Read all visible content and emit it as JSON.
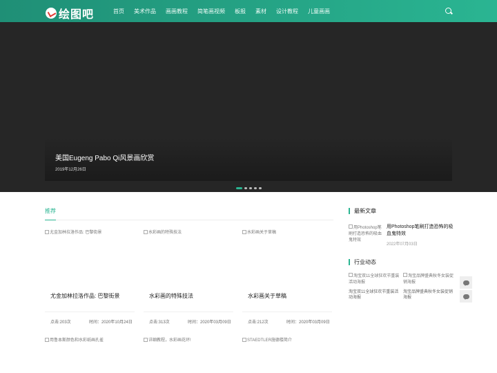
{
  "header": {
    "logo_text": "绘图吧",
    "nav": [
      "首页",
      "美术作品",
      "画画教程",
      "简笔画视频",
      "板报",
      "素材",
      "设计教程",
      "儿童画画"
    ]
  },
  "banner": {
    "title": "美国Eugeng Pabo Qi风景画欣赏",
    "date": "2019年12月26日"
  },
  "recommend": {
    "title": "推荐",
    "cards": [
      {
        "img_alt": "尤金加林拉洛作品: 巴黎街景",
        "title": "尤金加林拉洛作品: 巴黎街景",
        "views": "点击:203次",
        "time": "时间：2020年10月24日"
      },
      {
        "img_alt": "水彩画的特殊技法",
        "title": "水彩画的特殊技法",
        "views": "点击:313次",
        "time": "时间：2020年03月09日"
      },
      {
        "img_alt": "水彩画关于草稿",
        "title": "水彩画关于草稿",
        "views": "点击:212次",
        "time": "时间：2020年03月09日"
      }
    ],
    "more_cards": [
      {
        "img_alt": "用鲁本斯颜色和水彩纸画孔雀"
      },
      {
        "img_alt": "详细教程，水彩画花环!"
      },
      {
        "img_alt": "STAEDTLER施德楼简介"
      }
    ]
  },
  "sidebar": {
    "latest_title": "最新文章",
    "latest": {
      "img_alt": "用Photoshop笔刷打造恐怖的吸血鬼特效",
      "title": "用Photoshop笔刷打造恐怖的吸血鬼特效",
      "date": "2022年07月03日"
    },
    "industry_title": "行业动态",
    "industry": [
      {
        "img_alt": "淘宝双11全球狂欢节重装活动海报",
        "caption": "淘宝双11全球狂欢节重装活动海报"
      },
      {
        "img_alt": "淘宝品牌盛典秋冬女装促销海报",
        "caption": "淘宝品牌盛典秋冬女装促销海报"
      }
    ]
  },
  "colors": {
    "brand": "#2ab592",
    "header_dark": "#1f8f76",
    "banner_bg": "#262626"
  },
  "icons": [
    "search-icon",
    "comment-icon",
    "wechat-icon"
  ]
}
